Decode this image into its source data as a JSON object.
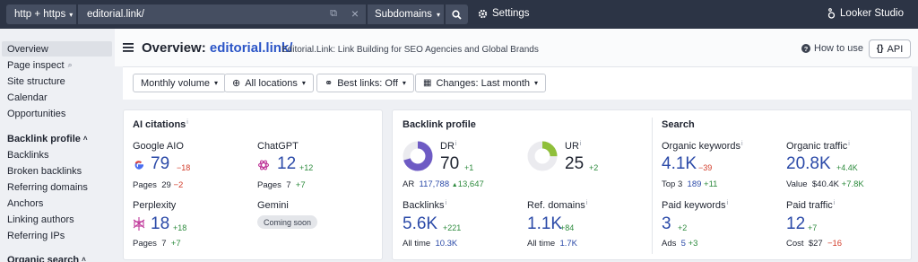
{
  "topbar": {
    "protocol": "http + https",
    "url": "editorial.link/",
    "scope": "Subdomains",
    "settings": "Settings",
    "looker": "Looker Studio"
  },
  "sidebar": {
    "items": [
      {
        "label": "Overview",
        "active": true
      },
      {
        "label": "Page inspect"
      },
      {
        "label": "Site structure"
      },
      {
        "label": "Calendar"
      },
      {
        "label": "Opportunities"
      },
      {
        "label": "Backlink profile",
        "header": true
      },
      {
        "label": "Backlinks"
      },
      {
        "label": "Broken backlinks"
      },
      {
        "label": "Referring domains"
      },
      {
        "label": "Anchors"
      },
      {
        "label": "Linking authors"
      },
      {
        "label": "Referring IPs"
      },
      {
        "label": "Organic search",
        "header": true
      }
    ]
  },
  "header": {
    "title_prefix": "Overview:",
    "title_domain": "editorial.link/",
    "subtitle": "Editorial.Link: Link Building for SEO Agencies and Global Brands",
    "how_to_use": "How to use",
    "api": "API"
  },
  "filters": {
    "volume": "Monthly volume",
    "locations": "All locations",
    "best_links": "Best links: Off",
    "changes": "Changes: Last month"
  },
  "ai_citations": {
    "title": "AI citations",
    "google": {
      "label": "Google AIO",
      "value": "79",
      "delta": "−18",
      "pages_label": "Pages",
      "pages": "29",
      "pages_delta": "−2"
    },
    "chatgpt": {
      "label": "ChatGPT",
      "value": "12",
      "delta": "+12",
      "pages_label": "Pages",
      "pages": "7",
      "pages_delta": "+7"
    },
    "perplexity": {
      "label": "Perplexity",
      "value": "18",
      "delta": "+18",
      "pages_label": "Pages",
      "pages": "7",
      "pages_delta": "+7"
    },
    "gemini": {
      "label": "Gemini",
      "badge": "Coming soon"
    }
  },
  "backlink_profile": {
    "title": "Backlink profile",
    "dr": {
      "label": "DR",
      "value": "70",
      "delta": "+1",
      "ring_fraction": 0.7
    },
    "ar": {
      "label": "AR",
      "value": "117,788",
      "delta": "13,647"
    },
    "ur": {
      "label": "UR",
      "value": "25",
      "delta": "+2",
      "ring_fraction": 0.25
    },
    "backlinks": {
      "label": "Backlinks",
      "value": "5.6K",
      "delta": "+221",
      "all_time_label": "All time",
      "all_time": "10.3K"
    },
    "ref_domains": {
      "label": "Ref. domains",
      "value": "1.1K",
      "delta": "+84",
      "all_time_label": "All time",
      "all_time": "1.7K"
    }
  },
  "search": {
    "title": "Search",
    "organic_keywords": {
      "label": "Organic keywords",
      "value": "4.1K",
      "delta": "−39",
      "sub_label": "Top 3",
      "sub_value": "189",
      "sub_delta": "+11"
    },
    "organic_traffic": {
      "label": "Organic traffic",
      "value": "20.8K",
      "delta": "+4.4K",
      "sub_label": "Value",
      "sub_value": "$40.4K",
      "sub_delta": "+7.8K"
    },
    "paid_keywords": {
      "label": "Paid keywords",
      "value": "3",
      "delta": "+2",
      "sub_label": "Ads",
      "sub_value": "5",
      "sub_delta": "+3"
    },
    "paid_traffic": {
      "label": "Paid traffic",
      "value": "12",
      "delta": "+7",
      "sub_label": "Cost",
      "sub_value": "$27",
      "sub_delta": "−16"
    }
  },
  "colors": {
    "topbar": "#2c3445",
    "accent_blue": "#2b4aa8",
    "positive": "#2e8b3e",
    "negative": "#d23c2a",
    "dr_ring": "#6e5bc4",
    "ur_ring": "#8fbf3a"
  }
}
